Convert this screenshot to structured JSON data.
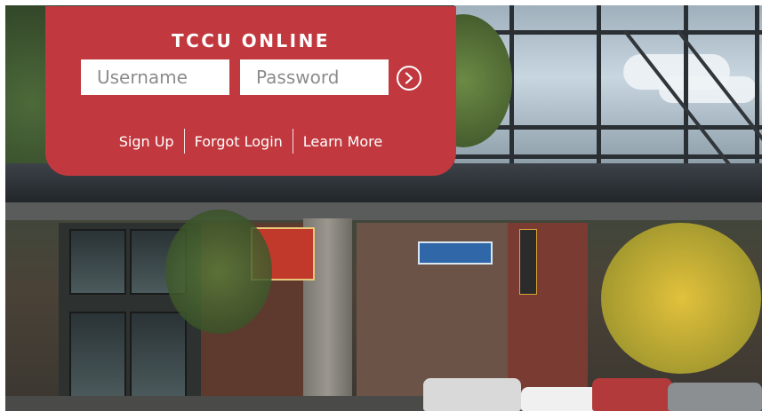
{
  "login": {
    "title": "TCCU ONLINE",
    "username_placeholder": "Username",
    "password_placeholder": "Password",
    "submit_icon": "chevron-right-circle-icon"
  },
  "links": {
    "sign_up": "Sign Up",
    "forgot_login": "Forgot Login",
    "learn_more": "Learn More"
  },
  "colors": {
    "card_background": "#c1393f",
    "text": "#ffffff"
  }
}
